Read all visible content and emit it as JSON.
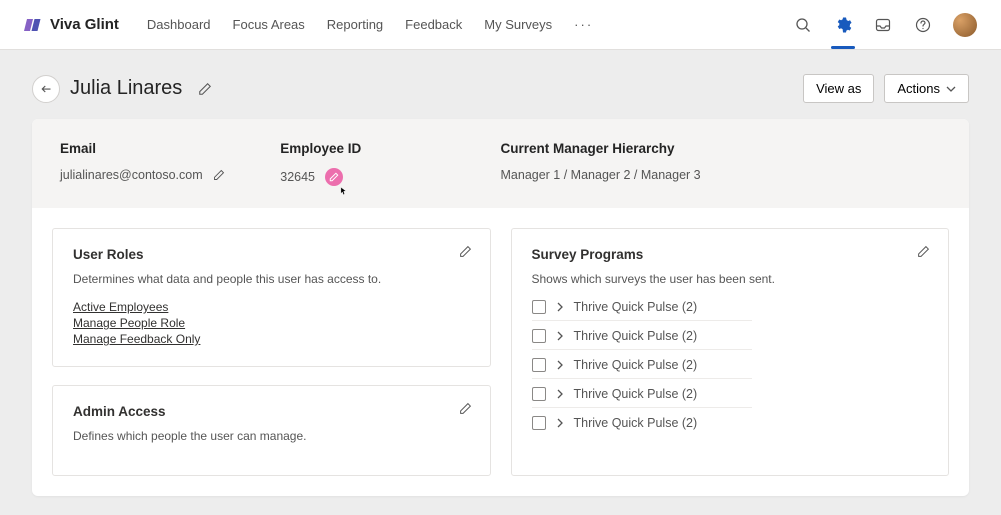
{
  "brand": {
    "name": "Viva Glint"
  },
  "nav": {
    "items": [
      "Dashboard",
      "Focus Areas",
      "Reporting",
      "Feedback",
      "My Surveys"
    ],
    "more": "···"
  },
  "header": {
    "title": "Julia Linares",
    "view_as": "View as",
    "actions": "Actions"
  },
  "info": {
    "email_label": "Email",
    "email_value": "julialinares@contoso.com",
    "empid_label": "Employee ID",
    "empid_value": "32645",
    "hierarchy_label": "Current Manager Hierarchy",
    "hierarchy_value": "Manager 1 / Manager 2 / Manager 3"
  },
  "roles_panel": {
    "title": "User Roles",
    "desc": "Determines what data and people this user has access to.",
    "links": [
      "Active Employees",
      "Manage People Role",
      "Manage Feedback Only"
    ]
  },
  "admin_panel": {
    "title": "Admin Access",
    "desc": "Defines which people the user can manage."
  },
  "surveys_panel": {
    "title": "Survey Programs",
    "desc": "Shows which surveys the user has been sent.",
    "items": [
      "Thrive Quick Pulse (2)",
      "Thrive Quick Pulse (2)",
      "Thrive Quick Pulse (2)",
      "Thrive Quick Pulse (2)",
      "Thrive Quick Pulse (2)"
    ]
  }
}
